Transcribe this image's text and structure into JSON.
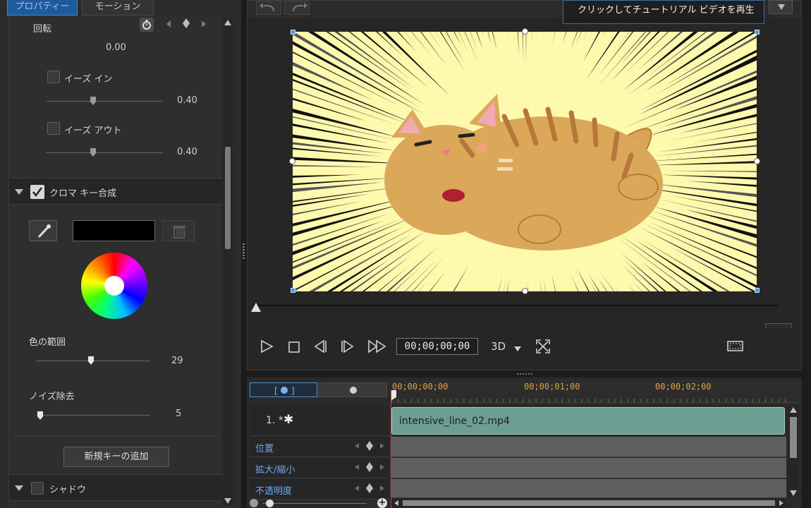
{
  "tabs": {
    "properties": "プロパティー",
    "motion": "モーション"
  },
  "rotation": {
    "label": "回転",
    "value": "0.00"
  },
  "ease_in": {
    "label": "イーズ イン",
    "value": "0.40"
  },
  "ease_out": {
    "label": "イーズ アウト",
    "value": "0.40"
  },
  "chroma": {
    "title": "クロマ キー合成",
    "checked": true,
    "key_color": "#000000"
  },
  "color_range": {
    "label": "色の範囲",
    "value": "29"
  },
  "noise": {
    "label": "ノイズ除去",
    "value": "5"
  },
  "add_key_button": "新規キーの追加",
  "shadow": {
    "title": "シャドウ",
    "checked": false
  },
  "tooltip": "クリックしてチュートリアル ビデオを再生",
  "player": {
    "timecode": "00;00;00;00",
    "mode_3d": "3D"
  },
  "timeline": {
    "ruler": [
      "00;00;00;00",
      "00;00;01;00",
      "00;00;02;00"
    ],
    "track_label": "1. *",
    "clip_name": "intensive_line_02.mp4",
    "rows": [
      "位置",
      "拡大/縮小",
      "不透明度"
    ]
  },
  "icons": [
    "stopwatch-icon",
    "prev-key-icon",
    "add-key-icon",
    "next-key-icon",
    "eyedropper-icon",
    "trash-icon",
    "color-wheel-icon",
    "undo-icon",
    "redo-icon",
    "play-icon",
    "stop-icon",
    "prev-frame-icon",
    "next-frame-icon",
    "fast-forward-icon",
    "fullscreen-icon",
    "safe-zone-icon",
    "chevron-down-icon"
  ]
}
